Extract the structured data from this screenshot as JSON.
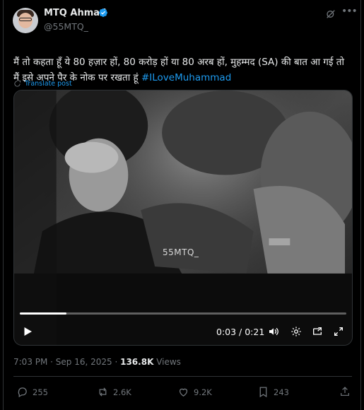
{
  "author": {
    "name": "MTQ Ahmad",
    "handle": "@55MTQ_"
  },
  "tweet": {
    "text": "मैं तो कहता हूँ ये 80 हज़ार हों, 80 करोड़ हों या 80 अरब हों, मुहम्मद (SA) की बात आ गई तो मैं इसे अपने पैर के नोक पर रखता हूं ",
    "hashtag": "#ILoveMuhammad",
    "translate_label": "Translate post"
  },
  "video": {
    "watermark": "55MTQ_",
    "time_display": "0:03 / 0:21",
    "progress_fraction": 0.143
  },
  "meta": {
    "timestamp": "7:03 PM · Sep 16, 2025 · ",
    "views_count": "136.8K",
    "views_label": " Views"
  },
  "actions": {
    "replies": "255",
    "reposts": "2.6K",
    "likes": "9.2K",
    "bookmarks": "243"
  },
  "colors": {
    "accent": "#1d9bf0",
    "muted": "#71767b",
    "background": "#000000"
  }
}
